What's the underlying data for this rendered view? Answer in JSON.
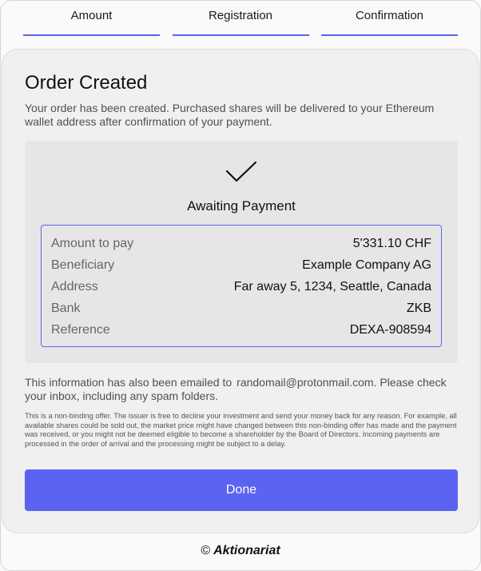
{
  "steps": [
    "Amount",
    "Registration",
    "Confirmation"
  ],
  "card": {
    "title": "Order Created",
    "intro": "Your order has been created. Purchased shares will be delivered to your Ethereum wallet address after confirmation of your payment.",
    "status_icon": "checkmark-icon",
    "status": "Awaiting Payment",
    "details": [
      {
        "label": "Amount to pay",
        "value": "5'331.10 CHF"
      },
      {
        "label": "Beneficiary",
        "value": "Example Company AG"
      },
      {
        "label": "Address",
        "value": "Far away 5, 1234, Seattle, Canada"
      },
      {
        "label": "Bank",
        "value": "ZKB"
      },
      {
        "label": "Reference",
        "value": "DEXA-908594"
      }
    ],
    "email_note_before": "This information has also been emailed to",
    "email": "randomail@protonmail.com.",
    "email_note_after": "Please check your inbox, including any spam folders.",
    "disclaimer": "This is a non-binding offer. The issuer is free to decline your investment and send your money back for any reason. For example, all available shares could be sold out, the market price might have changed between this non-binding offer has made and the payment was received, or you might not be deemed eligible to become a shareholder by the Board of Directors. Incoming payments are processed in the order of arrival and the processing might be subject to a delay.",
    "done_label": "Done"
  },
  "footer": {
    "copyright": "©",
    "brand": "Aktionariat"
  },
  "colors": {
    "accent": "#5c63f2",
    "card_bg": "#f0f0f0",
    "status_bg": "#e6e6e6"
  }
}
